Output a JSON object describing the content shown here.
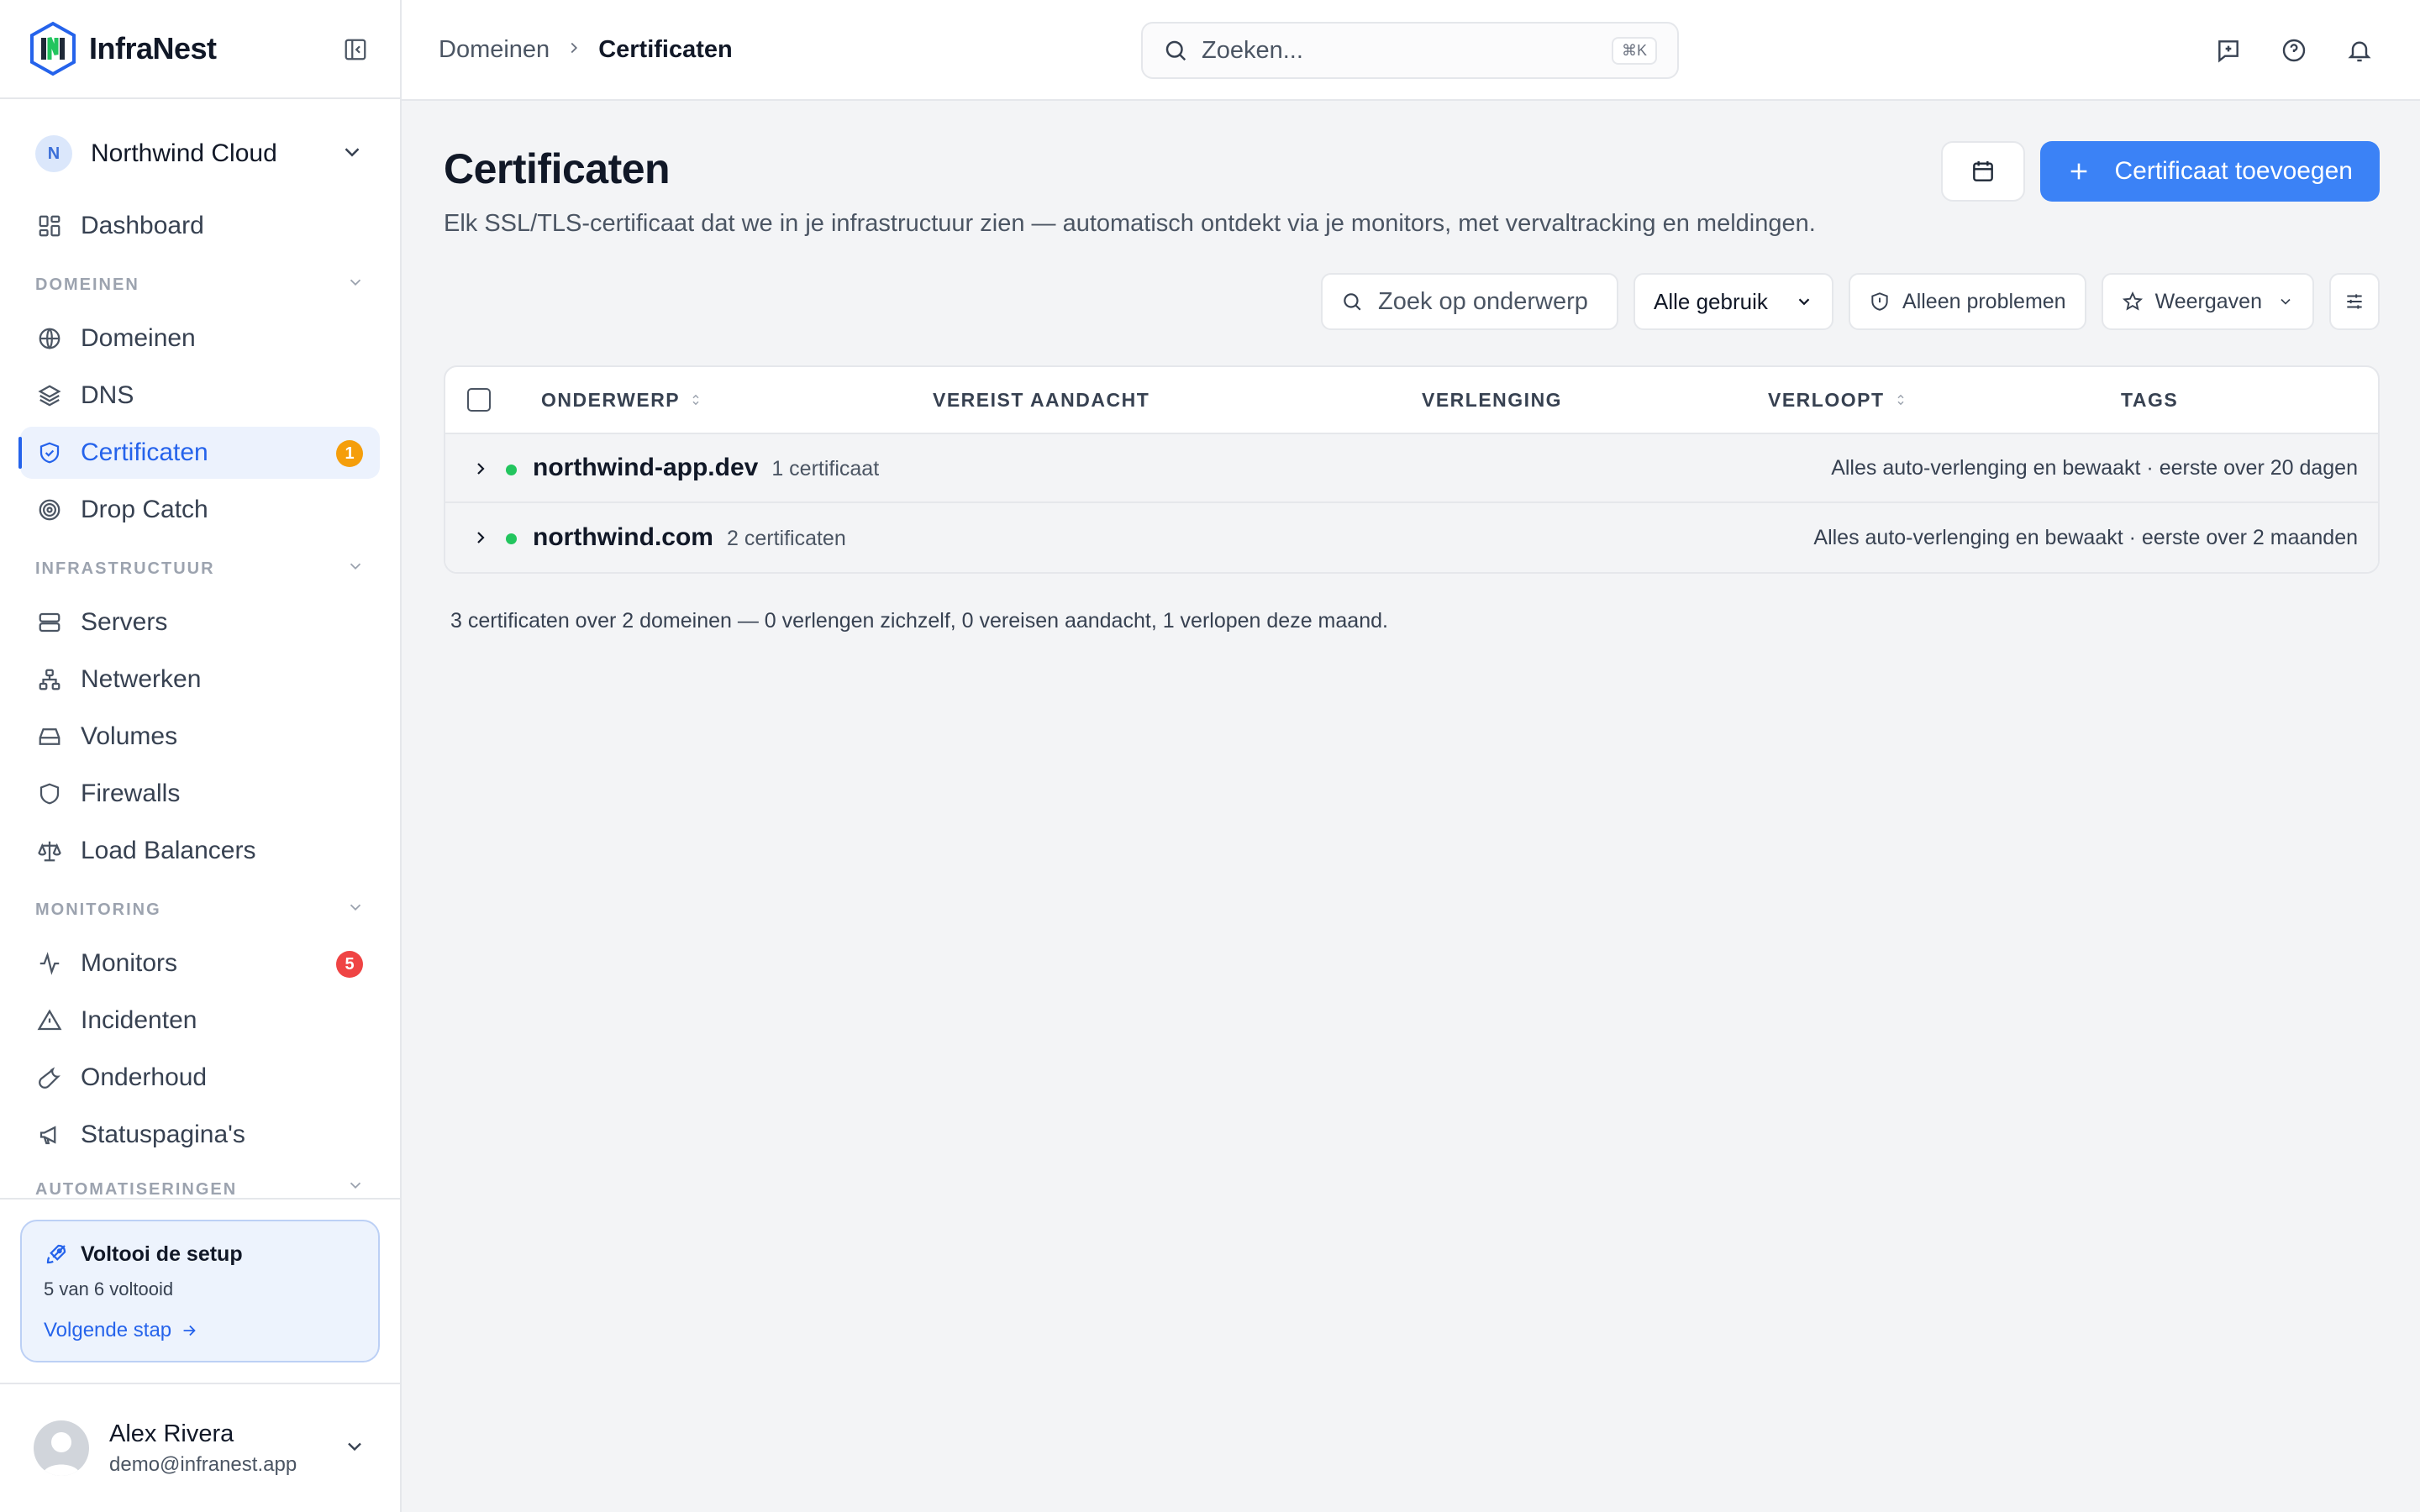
{
  "brand": {
    "name": "InfraNest"
  },
  "org": {
    "initial": "N",
    "name": "Northwind Cloud"
  },
  "nav": {
    "dashboard": "Dashboard",
    "sections": {
      "domeinen": "DOMEINEN",
      "infrastructuur": "INFRASTRUCTUUR",
      "monitoring": "MONITORING",
      "automatiseringen": "AUTOMATISERINGEN"
    },
    "domeinen": "Domeinen",
    "dns": "DNS",
    "certificaten": "Certificaten",
    "certificaten_badge": "1",
    "drop_catch": "Drop Catch",
    "servers": "Servers",
    "netwerken": "Netwerken",
    "volumes": "Volumes",
    "firewalls": "Firewalls",
    "load_balancers": "Load Balancers",
    "monitors": "Monitors",
    "monitors_badge": "5",
    "incidenten": "Incidenten",
    "onderhoud": "Onderhoud",
    "statuspaginas": "Statuspagina's"
  },
  "setup": {
    "title": "Voltooi de setup",
    "progress": "5 van 6 voltooid",
    "link": "Volgende stap"
  },
  "user": {
    "name": "Alex Rivera",
    "email": "demo@infranest.app"
  },
  "breadcrumb": {
    "parent": "Domeinen",
    "current": "Certificaten"
  },
  "search": {
    "placeholder": "Zoeken...",
    "shortcut": "⌘K"
  },
  "page": {
    "title": "Certificaten",
    "description": "Elk SSL/TLS-certificaat dat we in je infrastructuur zien — automatisch ontdekt via je monitors, met vervaltracking en meldingen.",
    "add_button": "Certificaat toevoegen"
  },
  "filters": {
    "subject_placeholder": "Zoek op onderwerp",
    "usage_selected": "Alle gebruik",
    "problems_only": "Alleen problemen",
    "views": "Weergaven"
  },
  "table": {
    "headers": {
      "subject": "ONDERWERP",
      "attention": "VEREIST AANDACHT",
      "renewal": "VERLENGING",
      "expires": "VERLOOPT",
      "tags": "TAGS"
    },
    "rows": [
      {
        "domain": "northwind-app.dev",
        "count": "1 certificaat",
        "status": "Alles auto-verlenging en bewaakt · eerste over 20 dagen"
      },
      {
        "domain": "northwind.com",
        "count": "2 certificaten",
        "status": "Alles auto-verlenging en bewaakt · eerste over 2 maanden"
      }
    ]
  },
  "summary": "3 certificaten over 2 domeinen — 0 verlengen zichzelf, 0 vereisen aandacht, 1 verlopen deze maand.",
  "colors": {
    "accent": "#3b82f6",
    "warning_badge": "#f59e0b",
    "danger_badge": "#ef4444",
    "status_ok": "#22c55e"
  }
}
